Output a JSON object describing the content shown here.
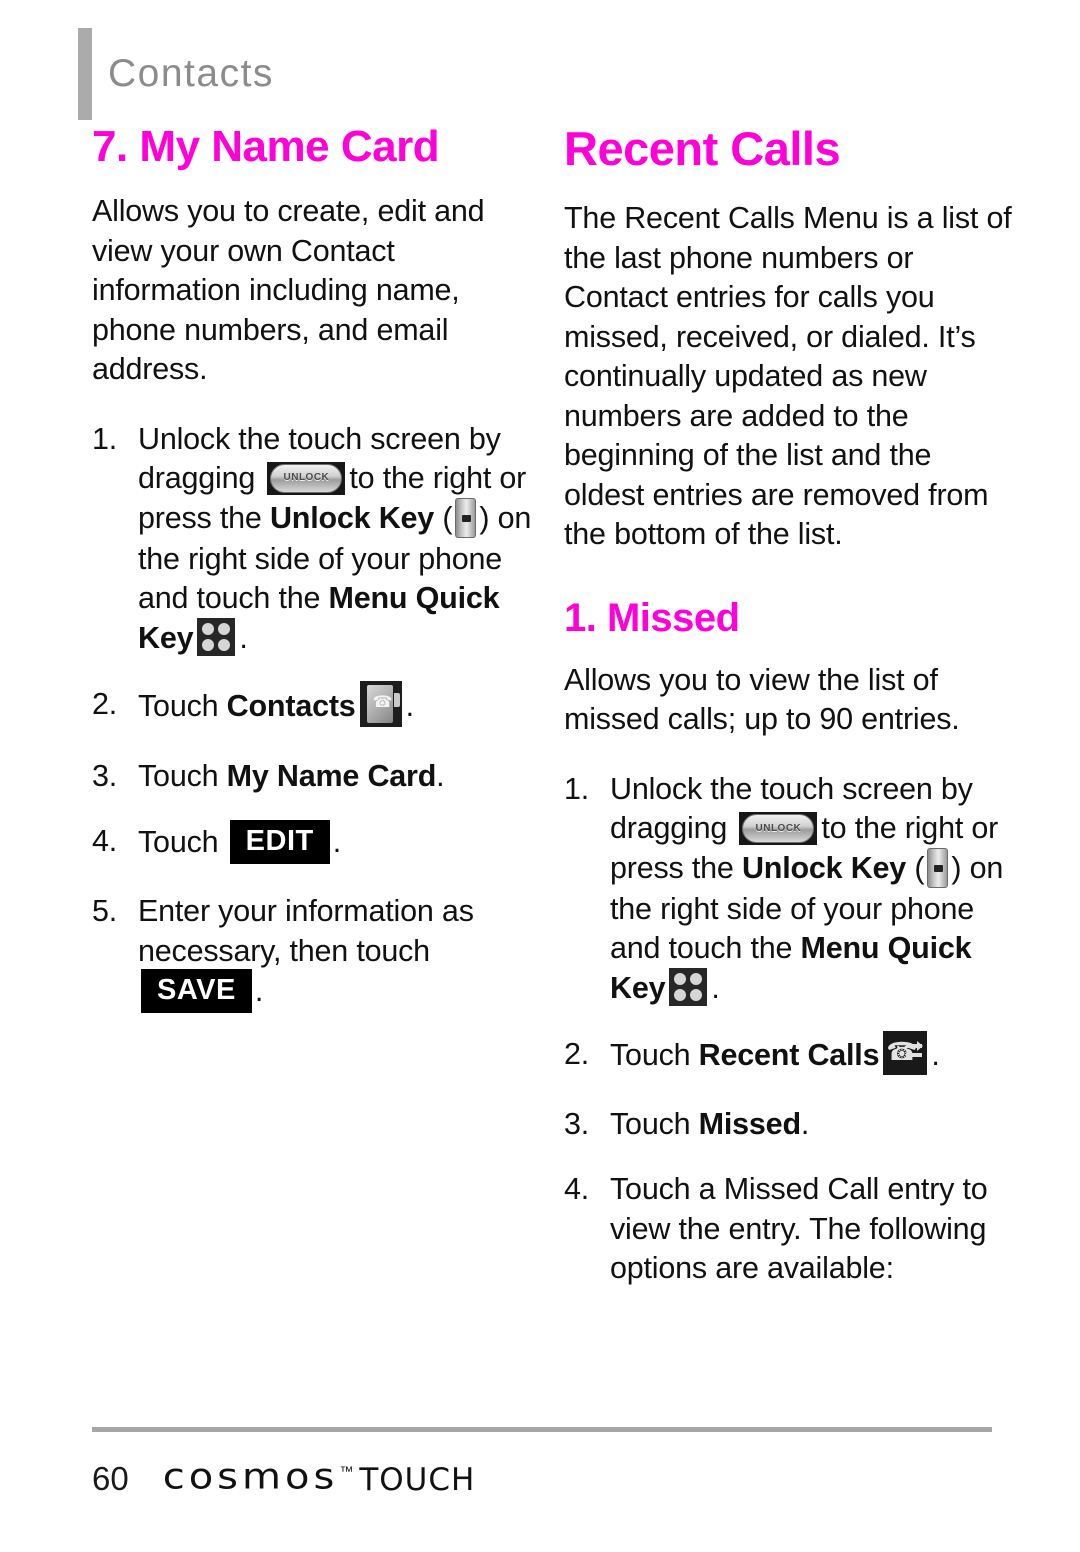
{
  "header": {
    "chapter_title": "Contacts"
  },
  "left_column": {
    "section_title": "7. My Name Card",
    "intro": "Allows you to create, edit and view your own Contact information including name, phone numbers, and email address.",
    "steps": [
      {
        "num": "1.",
        "part1": "Unlock the touch screen by dragging",
        "icon1": "unlock-slider-icon",
        "part2": "to the right or press the",
        "bold1": "Unlock Key",
        "paren_open": "(",
        "icon2": "unlock-key-icon",
        "paren_close": ")",
        "part3": "on the right side of your phone and touch the",
        "bold2": "Menu Quick Key",
        "icon3": "menu-quick-key-icon",
        "period": "."
      },
      {
        "num": "2.",
        "part1": "Touch",
        "bold1": "Contacts",
        "icon1": "contacts-icon",
        "period": "."
      },
      {
        "num": "3.",
        "part1": "Touch",
        "bold1": "My Name Card",
        "period": "."
      },
      {
        "num": "4.",
        "part1": "Touch",
        "softkey": "EDIT",
        "period": "."
      },
      {
        "num": "5.",
        "part1": "Enter your information as necessary, then touch",
        "softkey": "SAVE",
        "period": "."
      }
    ]
  },
  "right_column": {
    "section_title": "Recent Calls",
    "intro": "The Recent Calls Menu is a list of the last phone numbers or Contact entries for calls you missed, received, or dialed. It’s continually updated as new numbers are added to the beginning of the list and the oldest entries are removed from the bottom of the list.",
    "subsection_title": "1. Missed",
    "subsection_intro": "Allows you to view the list of missed calls; up to 90 entries.",
    "steps": [
      {
        "num": "1.",
        "part1": "Unlock the touch screen by dragging",
        "icon1": "unlock-slider-icon",
        "part2": "to the right or press the",
        "bold1": "Unlock Key",
        "paren_open": "(",
        "icon2": "unlock-key-icon",
        "paren_close": ")",
        "part3": "on the right side of your phone and touch the",
        "bold2": "Menu Quick Key",
        "icon3": "menu-quick-key-icon",
        "period": "."
      },
      {
        "num": "2.",
        "part1": "Touch",
        "bold1": "Recent Calls",
        "icon1": "recent-calls-icon",
        "period": "."
      },
      {
        "num": "3.",
        "part1": "Touch",
        "bold1": "Missed",
        "period": "."
      },
      {
        "num": "4.",
        "part1": "Touch a Missed Call entry to view the entry. The following options are available:"
      }
    ]
  },
  "icons": {
    "unlock_slider_label": "UNLOCK"
  },
  "footer": {
    "page_number": "60",
    "brand_name": "cosmos",
    "brand_tm": "™",
    "brand_suffix": "TOUCH"
  },
  "colors": {
    "heading_magenta": "#ff00d8",
    "header_gray": "#8c8c8c",
    "rule_gray": "#a6a6a6",
    "body_black": "#111111"
  }
}
